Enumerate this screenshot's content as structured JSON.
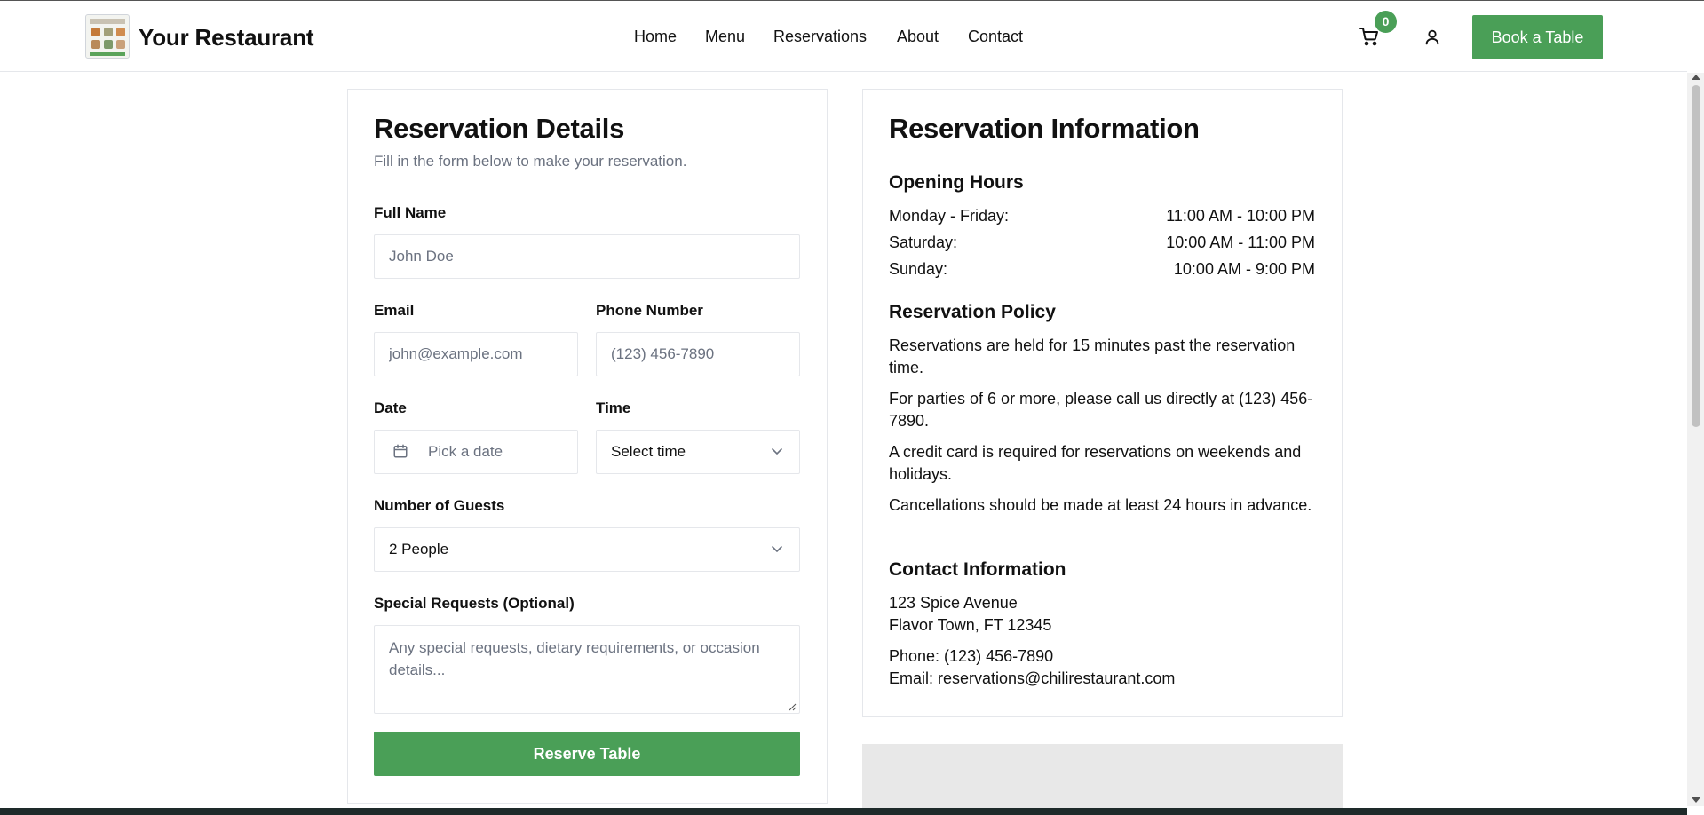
{
  "header": {
    "brand": "Your Restaurant",
    "nav": [
      "Home",
      "Menu",
      "Reservations",
      "About",
      "Contact"
    ],
    "cart_count": "0",
    "book_button": "Book a Table",
    "accent_color": "#4a9f57"
  },
  "form": {
    "title": "Reservation Details",
    "subtitle": "Fill in the form below to make your reservation.",
    "full_name_label": "Full Name",
    "full_name_placeholder": "John Doe",
    "email_label": "Email",
    "email_placeholder": "john@example.com",
    "phone_label": "Phone Number",
    "phone_placeholder": "(123) 456-7890",
    "date_label": "Date",
    "date_placeholder": "Pick a date",
    "time_label": "Time",
    "time_value": "Select time",
    "guests_label": "Number of Guests",
    "guests_value": "2 People",
    "requests_label": "Special Requests (Optional)",
    "requests_placeholder": "Any special requests, dietary requirements, or occasion details...",
    "submit_label": "Reserve Table"
  },
  "info": {
    "title": "Reservation Information",
    "hours_title": "Opening Hours",
    "hours": [
      {
        "day": "Monday - Friday:",
        "time": "11:00 AM - 10:00 PM"
      },
      {
        "day": "Saturday:",
        "time": "10:00 AM - 11:00 PM"
      },
      {
        "day": "Sunday:",
        "time": "10:00 AM - 9:00 PM"
      }
    ],
    "policy_title": "Reservation Policy",
    "policy": [
      "Reservations are held for 15 minutes past the reservation time.",
      "For parties of 6 or more, please call us directly at (123) 456-7890.",
      "A credit card is required for reservations on weekends and holidays.",
      "Cancellations should be made at least 24 hours in advance."
    ],
    "contact_title": "Contact Information",
    "address_line1": "123 Spice Avenue",
    "address_line2": "Flavor Town, FT 12345",
    "phone": "Phone: (123) 456-7890",
    "email": "Email: reservations@chilirestaurant.com"
  }
}
